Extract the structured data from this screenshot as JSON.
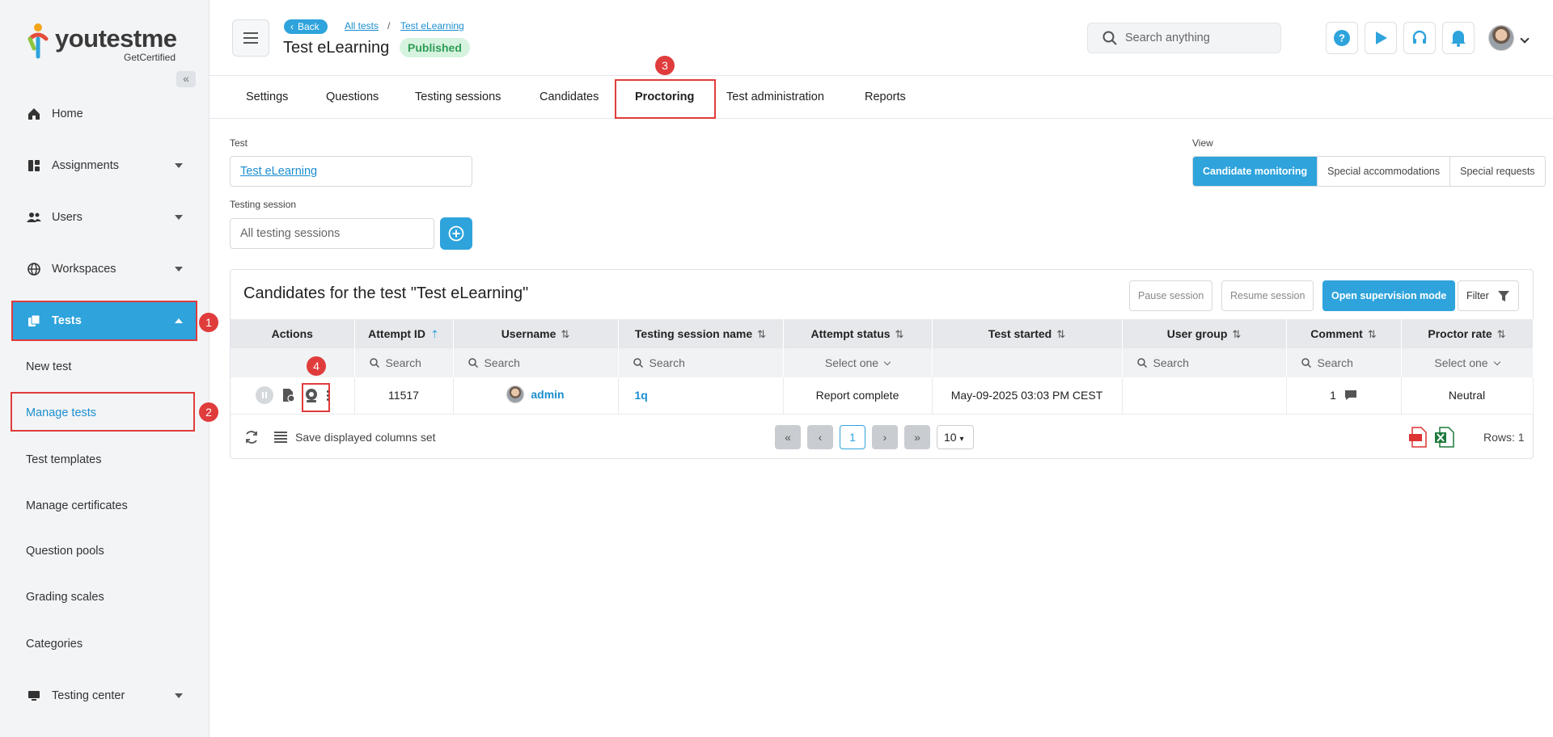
{
  "brand": {
    "name": "youtestme",
    "tagline": "GetCertified",
    "accent": "#2ea3dc"
  },
  "sidebar": {
    "items": [
      {
        "label": "Home",
        "icon": "home-icon"
      },
      {
        "label": "Assignments",
        "icon": "assignments-icon"
      },
      {
        "label": "Users",
        "icon": "users-icon"
      },
      {
        "label": "Workspaces",
        "icon": "globe-icon"
      },
      {
        "label": "Tests",
        "icon": "tests-icon"
      },
      {
        "label": "Testing center",
        "icon": "monitor-icon"
      }
    ],
    "sub_items": [
      "New test",
      "Manage tests",
      "Test templates",
      "Manage certificates",
      "Question pools",
      "Grading scales",
      "Categories"
    ]
  },
  "header": {
    "back_label": "Back",
    "breadcrumbs": [
      "All tests",
      "Test eLearning"
    ],
    "separator": "/",
    "title": "Test eLearning",
    "status": "Published",
    "search_placeholder": "Search anything"
  },
  "tabs": [
    "Settings",
    "Questions",
    "Testing sessions",
    "Candidates",
    "Proctoring",
    "Test administration",
    "Reports"
  ],
  "active_tab": "Proctoring",
  "form": {
    "test_label": "Test",
    "test_value": "Test eLearning",
    "session_label": "Testing session",
    "session_placeholder": "All testing sessions",
    "view_label": "View",
    "view_options": [
      "Candidate monitoring",
      "Special accommodations",
      "Special requests"
    ]
  },
  "panel": {
    "title": "Candidates for the test \"Test eLearning\"",
    "buttons": {
      "pause": "Pause session",
      "resume": "Resume session",
      "supervision": "Open supervision mode",
      "filter": "Filter"
    },
    "columns": [
      "Actions",
      "Attempt ID",
      "Username",
      "Testing session name",
      "Attempt status",
      "Test started",
      "User group",
      "Comment",
      "Proctor rate"
    ],
    "filters": {
      "search": "Search",
      "select": "Select one"
    },
    "rows": [
      {
        "attempt_id": "11517",
        "username": "admin",
        "session": "1q",
        "status": "Report complete",
        "started": "May-09-2025 03:03 PM CEST",
        "group": "",
        "comment_count": "1",
        "rate": "Neutral"
      }
    ],
    "footer": {
      "save_columns": "Save displayed columns set",
      "page": "1",
      "per_page": "10",
      "rows": "Rows: 1"
    }
  },
  "annotations": [
    "1",
    "2",
    "3",
    "4"
  ]
}
